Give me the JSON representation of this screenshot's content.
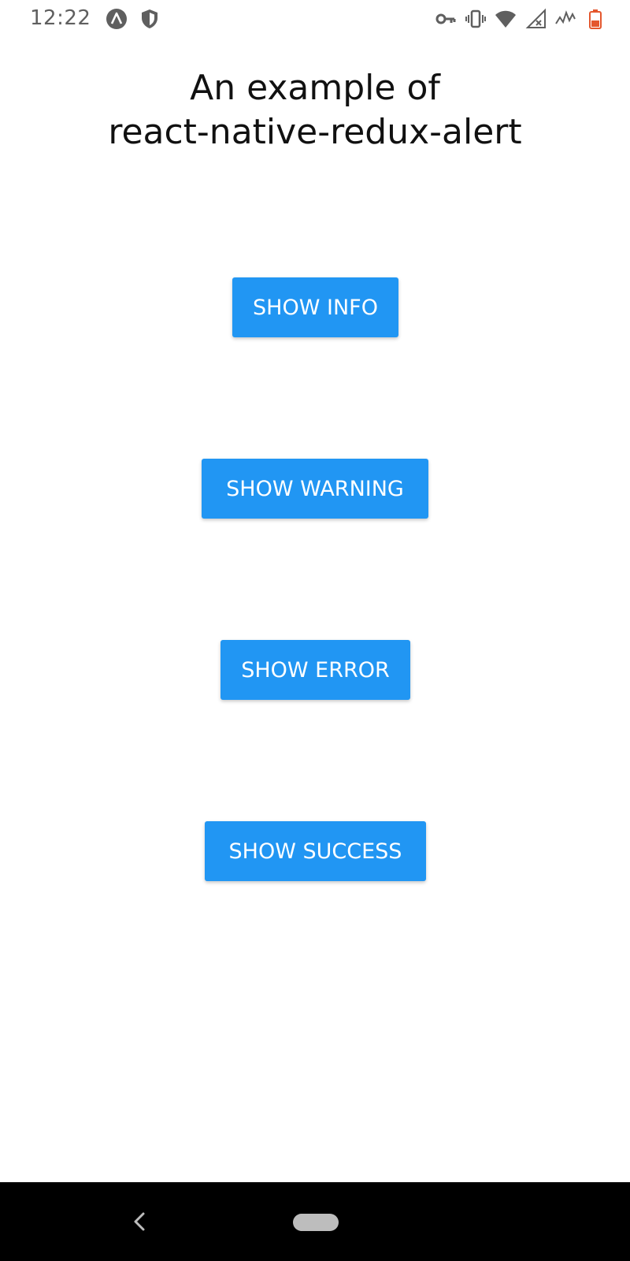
{
  "status_bar": {
    "time": "12:22",
    "left_icons": [
      "android-studio-icon",
      "shield-icon"
    ],
    "right_icons": [
      "vpn-key-icon",
      "vibrate-icon",
      "wifi-icon",
      "no-signal-icon",
      "signal-icon",
      "battery-icon"
    ]
  },
  "title": {
    "line1": "An example of",
    "line2": "react-native-redux-alert"
  },
  "buttons": {
    "info": "SHOW INFO",
    "warning": "SHOW WARNING",
    "error": "SHOW ERROR",
    "success": "SHOW SUCCESS"
  },
  "nav_bar": {
    "icons": [
      "back-icon",
      "home-pill-icon"
    ]
  },
  "colors": {
    "button_bg": "#2196f3",
    "button_text": "#ffffff",
    "battery_low": "#e4572e"
  }
}
